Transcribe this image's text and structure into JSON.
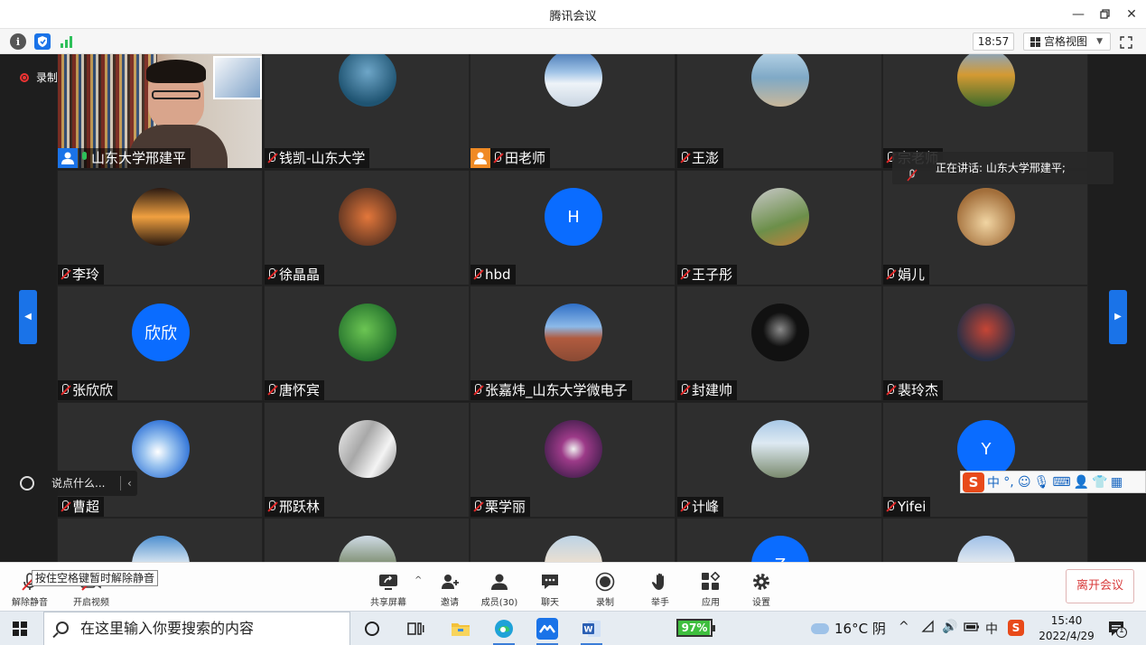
{
  "window": {
    "title": "腾讯会议"
  },
  "toolbar": {
    "time": "18:57",
    "view_mode": "宫格视图"
  },
  "recording": {
    "label": "录制中"
  },
  "participants": [
    {
      "name": "山东大学邢建平",
      "kind": "video",
      "mic": "on",
      "host": true
    },
    {
      "name": "钱凯-山东大学",
      "kind": "photo",
      "photo": "sea",
      "mic": "muted"
    },
    {
      "name": "田老师",
      "kind": "photo",
      "photo": "snow",
      "mic": "muted",
      "cohost": true
    },
    {
      "name": "王澎",
      "kind": "photo",
      "photo": "beach",
      "mic": "muted"
    },
    {
      "name": "宗老师",
      "kind": "photo",
      "photo": "autumn",
      "mic": "muted"
    },
    {
      "name": "李玲",
      "kind": "photo",
      "photo": "sunset",
      "mic": "muted"
    },
    {
      "name": "徐晶晶",
      "kind": "photo",
      "photo": "person",
      "mic": "muted"
    },
    {
      "name": "hbd",
      "kind": "letter",
      "letter": "H",
      "mic": "muted"
    },
    {
      "name": "王子彤",
      "kind": "photo",
      "photo": "outdoor",
      "mic": "muted"
    },
    {
      "name": "娟儿",
      "kind": "photo",
      "photo": "cat",
      "mic": "muted"
    },
    {
      "name": "张欣欣",
      "kind": "letter",
      "letter": "欣欣",
      "mic": "muted"
    },
    {
      "name": "唐怀宾",
      "kind": "photo",
      "photo": "leaves",
      "mic": "muted"
    },
    {
      "name": "张嘉炜_山东大学微电子",
      "kind": "photo",
      "photo": "building",
      "mic": "muted"
    },
    {
      "name": "封建帅",
      "kind": "photo",
      "photo": "dark",
      "mic": "muted"
    },
    {
      "name": "裴玲杰",
      "kind": "photo",
      "photo": "hero",
      "mic": "muted"
    },
    {
      "name": "曹超",
      "kind": "photo",
      "photo": "sky",
      "mic": "muted"
    },
    {
      "name": "邢跃林",
      "kind": "photo",
      "photo": "tower",
      "mic": "muted"
    },
    {
      "name": "栗学丽",
      "kind": "photo",
      "photo": "flowers",
      "mic": "muted"
    },
    {
      "name": "计峰",
      "kind": "photo",
      "photo": "mountain",
      "mic": "muted"
    },
    {
      "name": "Yifei",
      "kind": "letter",
      "letter": "Y",
      "mic": "muted"
    },
    {
      "name": "",
      "kind": "photo",
      "photo": "lake",
      "mic": "muted"
    },
    {
      "name": "",
      "kind": "photo",
      "photo": "church",
      "mic": "muted"
    },
    {
      "name": "",
      "kind": "photo",
      "photo": "desert",
      "mic": "muted"
    },
    {
      "name": "",
      "kind": "letter",
      "letter": "Z",
      "mic": "muted"
    },
    {
      "name": "",
      "kind": "photo",
      "photo": "city",
      "mic": "muted"
    }
  ],
  "speaking": {
    "text": "正在讲话: 山东大学邢建平;"
  },
  "chat_pill": {
    "placeholder": "说点什么..."
  },
  "ime_bar": {
    "lang": "中",
    "punct": "°,"
  },
  "controls": {
    "unmute": "解除静音",
    "start_video": "开启视频",
    "share_screen": "共享屏幕",
    "invite": "邀请",
    "members": "成员(30)",
    "chat": "聊天",
    "record": "录制",
    "raise_hand": "举手",
    "apps": "应用",
    "settings": "设置",
    "leave": "离开会议",
    "tooltip": "按住空格键暂时解除静音"
  },
  "taskbar": {
    "search_placeholder": "在这里输入你要搜索的内容",
    "battery_app": "97%",
    "battery_level": 0.97,
    "weather": "16°C 阴",
    "ime_lang": "中",
    "time": "15:40",
    "date": "2022/4/29",
    "notif_count": "1"
  },
  "colors": {
    "accent": "#0a6cff",
    "muted_red": "#e02828",
    "leave_red": "#d83b3b"
  }
}
